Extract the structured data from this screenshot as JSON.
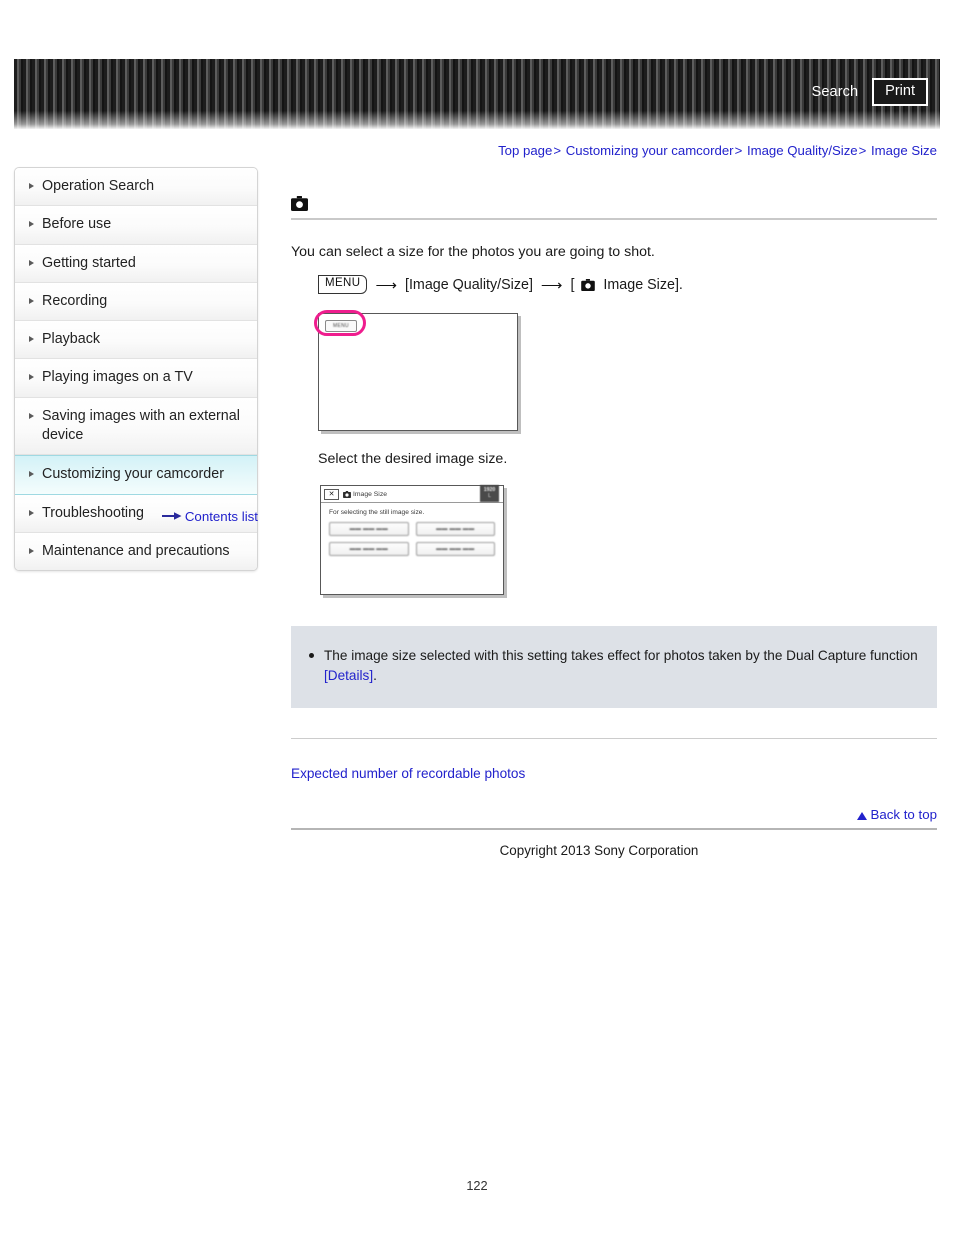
{
  "header": {
    "search_label": "Search",
    "print_label": "Print"
  },
  "breadcrumb": {
    "items": [
      {
        "label": "Top page"
      },
      {
        "label": "Customizing your camcorder"
      },
      {
        "label": "Image Quality/Size"
      },
      {
        "label": "Image Size"
      }
    ],
    "separator": ">"
  },
  "sidebar": {
    "items": [
      {
        "label": "Operation Search",
        "active": false
      },
      {
        "label": "Before use",
        "active": false
      },
      {
        "label": "Getting started",
        "active": false
      },
      {
        "label": "Recording",
        "active": false
      },
      {
        "label": "Playback",
        "active": false
      },
      {
        "label": "Playing images on a TV",
        "active": false
      },
      {
        "label": "Saving images with an external device",
        "active": false
      },
      {
        "label": "Customizing your camcorder",
        "active": true
      },
      {
        "label": "Troubleshooting",
        "active": false
      },
      {
        "label": "Maintenance and precautions",
        "active": false
      }
    ],
    "contents_list_label": "Contents list"
  },
  "main": {
    "title_icon": "camera-icon",
    "intro_text": "You can select a size for the photos you are going to shot.",
    "step": {
      "menu_chip": "MENU",
      "arrow": "⟶",
      "part1": "[Image Quality/Size]",
      "bracket_open": "[",
      "part2": "Image Size].",
      "icon": "camera-icon"
    },
    "screenshot1": {
      "menu_button_label": "MENU",
      "highlight_color": "#ef1d8e"
    },
    "caption": "Select the desired image size.",
    "screenshot2": {
      "close_label": "✕",
      "title": "Image Size",
      "badge_top": "1920",
      "badge_bottom": "L",
      "description": "For selecting the still image size.",
      "options": [
        {
          "label": "▬▬ ▬▬ ▬▬"
        },
        {
          "label": "▬▬ ▬▬ ▬▬"
        },
        {
          "label": "▬▬ ▬▬ ▬▬"
        },
        {
          "label": "▬▬ ▬▬ ▬▬"
        }
      ]
    },
    "note": {
      "text": "The image size selected with this setting takes effect for photos taken by the Dual Capture function ",
      "link_label": "[Details]",
      "tail": "."
    },
    "expected_link_label": "Expected number of recordable photos"
  },
  "footer": {
    "back_to_top_label": "Back to top",
    "copyright": "Copyright 2013 Sony Corporation",
    "page_number": "122"
  },
  "colors": {
    "link": "#2222cc",
    "note_bg": "#dde1e7",
    "active_sidebar": "#d3f2f7",
    "highlight": "#ef1d8e"
  }
}
